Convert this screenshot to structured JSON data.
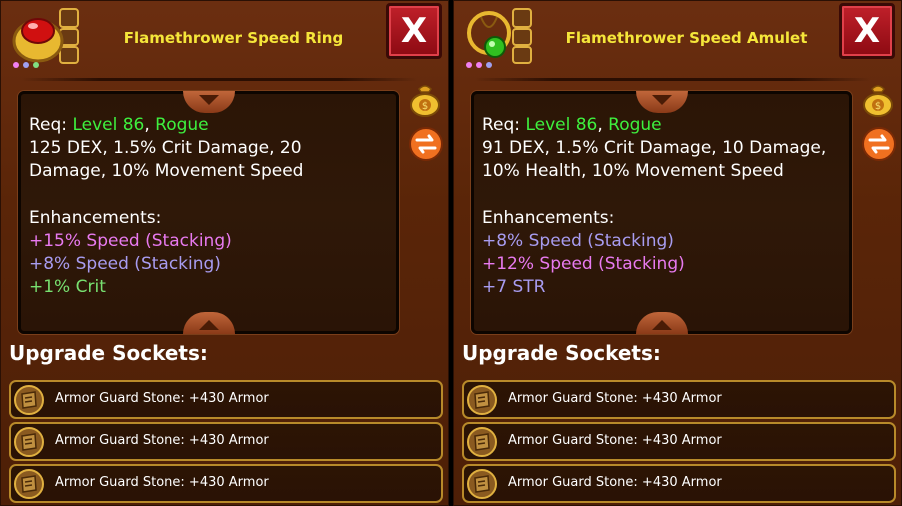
{
  "panels": [
    {
      "title": "Flamethrower Speed Ring",
      "close_label": "X",
      "req_label": "Req:",
      "req_level": "Level 86",
      "req_sep": ",",
      "req_class": "Rogue",
      "stats_line1": "125 DEX, 1.5% Crit Damage, 20",
      "stats_line2": "Damage, 10% Movement Speed",
      "enh_label": "Enhancements:",
      "enh": [
        {
          "text": "+15% Speed (Stacking)",
          "color": "#e87af0"
        },
        {
          "text": "+8% Speed (Stacking)",
          "color": "#a89cf0"
        },
        {
          "text": "+1% Crit",
          "color": "#78e070"
        }
      ],
      "sockets_title": "Upgrade Sockets:",
      "sockets": [
        "Armor Guard Stone: +430 Armor",
        "Armor Guard Stone: +430 Armor",
        "Armor Guard Stone: +430 Armor"
      ],
      "gem_color": "#d01010"
    },
    {
      "title": "Flamethrower Speed Amulet",
      "close_label": "X",
      "req_label": "Req:",
      "req_level": "Level 86",
      "req_sep": ",",
      "req_class": "Rogue",
      "stats_line1": "91 DEX, 1.5% Crit Damage, 10 Damage,",
      "stats_line2": "10% Health, 10% Movement Speed",
      "enh_label": "Enhancements:",
      "enh": [
        {
          "text": "+8% Speed (Stacking)",
          "color": "#a89cf0"
        },
        {
          "text": "+12% Speed (Stacking)",
          "color": "#e87af0"
        },
        {
          "text": "+7 STR",
          "color": "#a89cf0"
        }
      ],
      "sockets_title": "Upgrade Sockets:",
      "sockets": [
        "Armor Guard Stone: +430 Armor",
        "Armor Guard Stone: +430 Armor",
        "Armor Guard Stone: +430 Armor"
      ],
      "gem_color": "#30c020"
    }
  ],
  "colors": {
    "title": "#f5e63a",
    "req_green": "#3ef03e",
    "socket_border": "#b88a2a",
    "close_red": "#c0202a"
  },
  "icons": {
    "item": "item-icon",
    "bag": "gold-bag-icon",
    "swap": "swap-arrows-icon",
    "stone": "armor-guard-stone-icon"
  }
}
